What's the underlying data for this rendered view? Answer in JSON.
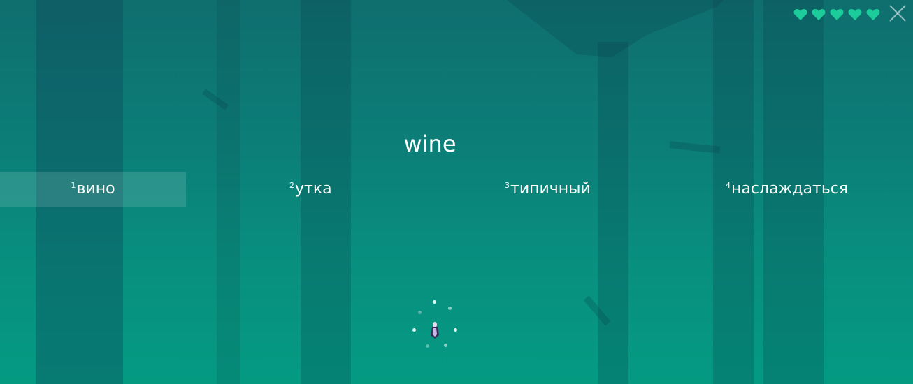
{
  "lives": {
    "count": 5,
    "icon": "heart-icon",
    "color": "#1ccc9a"
  },
  "close_icon": "close-icon",
  "prompt": {
    "word": "wine"
  },
  "answers": [
    {
      "number": "1",
      "text": "вино",
      "selected": true
    },
    {
      "number": "2",
      "text": "утка",
      "selected": false
    },
    {
      "number": "3",
      "text": "типичный",
      "selected": false
    },
    {
      "number": "4",
      "text": "наслаждаться",
      "selected": false
    }
  ],
  "loader": {
    "icon": "character-icon"
  },
  "colors": {
    "background_top": "#0f6e6e",
    "background_bottom": "#049a82",
    "heart": "#1ccc9a",
    "text": "#ffffff"
  }
}
